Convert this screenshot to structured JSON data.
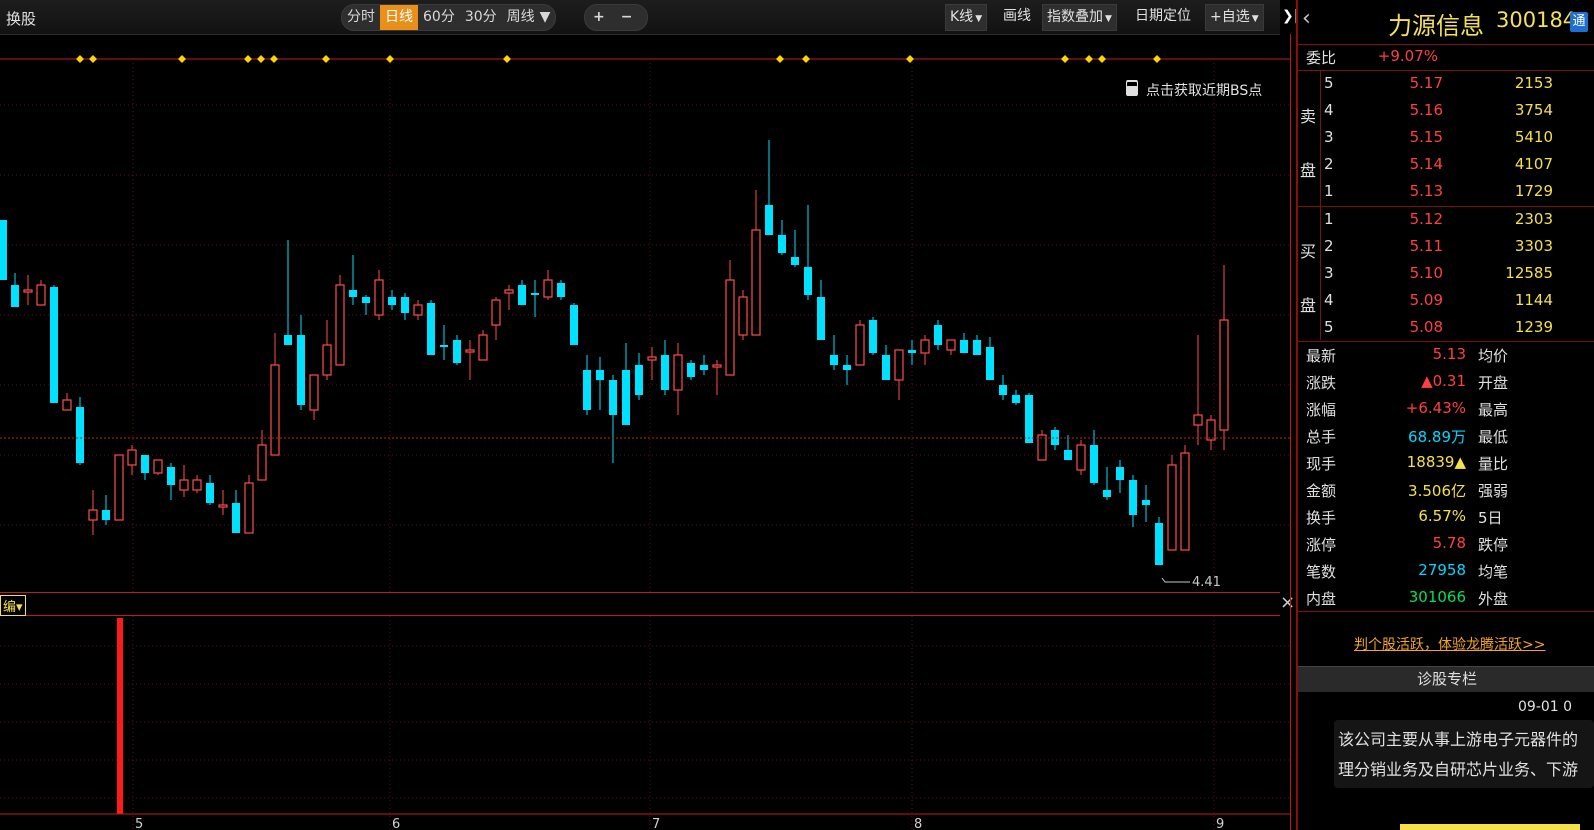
{
  "toolbar": {
    "left_label": "换股",
    "periods": [
      "分时",
      "日线",
      "60分",
      "30分",
      "周线"
    ],
    "active_period": "日线",
    "zoom_in": "+",
    "zoom_out": "−",
    "kline_label": "K线",
    "draw_label": "画线",
    "index_overlay_label": "指数叠加",
    "date_locate_label": "日期定位",
    "add_watch_label": "+自选",
    "collapse_icon": "❯|"
  },
  "chart": {
    "bs_prompt": "点击获取近期BS点",
    "low_label": "4.41",
    "colors": {
      "up": "#ff4d4d",
      "down": "#00e0ff",
      "marker": "#ffd400",
      "grid": "#5a1010"
    }
  },
  "indicator": {
    "header_label": "编",
    "close_icon": "×"
  },
  "x_axis": {
    "labels": [
      "5",
      "6",
      "7",
      "8",
      "9"
    ]
  },
  "chart_data": {
    "type": "candlestick",
    "y_range": [
      4.35,
      5.85
    ],
    "x_axis_labels": [
      "5",
      "6",
      "7",
      "8",
      "9"
    ],
    "candles": [
      {
        "o": 5.08,
        "h": 5.12,
        "l": 4.95,
        "c": 5.22,
        "up": true
      },
      {
        "o": 5.12,
        "h": 5.13,
        "l": 5.03,
        "c": 5.05,
        "up": false
      },
      {
        "o": 5.1,
        "h": 5.15,
        "l": 5.03,
        "c": 5.11,
        "up": true
      },
      {
        "o": 5.11,
        "h": 5.14,
        "l": 5.02,
        "c": 5.06,
        "up": false
      },
      {
        "o": 5.07,
        "h": 5.16,
        "l": 5.03,
        "c": 5.1,
        "up": true
      },
      {
        "o": 5.1,
        "h": 5.11,
        "l": 4.85,
        "c": 4.87,
        "up": false
      },
      {
        "o": 4.86,
        "h": 4.88,
        "l": 4.82,
        "c": 4.84,
        "up": false
      },
      {
        "o": 4.84,
        "h": 4.86,
        "l": 4.64,
        "c": 4.66,
        "up": false
      }
    ],
    "annotation_low": 4.41
  },
  "right_panel": {
    "back_icon": "‹",
    "stock_name": "力源信息",
    "stock_code": "300184",
    "badge": "通",
    "weibi_label": "委比",
    "weibi_value": "+9.07%",
    "sell_side_label_1": "卖",
    "sell_side_label_2": "盘",
    "buy_side_label_1": "买",
    "buy_side_label_2": "盘",
    "sell": [
      {
        "level": "5",
        "price": "5.17",
        "vol": "2153"
      },
      {
        "level": "4",
        "price": "5.16",
        "vol": "3754"
      },
      {
        "level": "3",
        "price": "5.15",
        "vol": "5410"
      },
      {
        "level": "2",
        "price": "5.14",
        "vol": "4107"
      },
      {
        "level": "1",
        "price": "5.13",
        "vol": "1729"
      }
    ],
    "buy": [
      {
        "level": "1",
        "price": "5.12",
        "vol": "2303"
      },
      {
        "level": "2",
        "price": "5.11",
        "vol": "3303"
      },
      {
        "level": "3",
        "price": "5.10",
        "vol": "12585"
      },
      {
        "level": "4",
        "price": "5.09",
        "vol": "1144"
      },
      {
        "level": "5",
        "price": "5.08",
        "vol": "1239"
      }
    ],
    "stats": [
      {
        "label": "最新",
        "value": "5.13",
        "label2": "均价"
      },
      {
        "label": "涨跌",
        "value": "▲0.31",
        "label2": "开盘"
      },
      {
        "label": "涨幅",
        "value": "+6.43%",
        "label2": "最高"
      },
      {
        "label": "总手",
        "value": "68.89万",
        "label2": "最低"
      },
      {
        "label": "现手",
        "value": "18839▲",
        "label2": "量比"
      },
      {
        "label": "金额",
        "value": "3.506亿",
        "label2": "强弱"
      },
      {
        "label": "换手",
        "value": "6.57%",
        "label2": "5日"
      },
      {
        "label": "涨停",
        "value": "5.78",
        "label2": "跌停"
      },
      {
        "label": "笔数",
        "value": "27958",
        "label2": "均笔"
      },
      {
        "label": "内盘",
        "value": "301066",
        "label2": "外盘"
      }
    ],
    "promo_link": "判个股活跃，体验龙腾活跃>>",
    "column_title": "诊股专栏",
    "news_date": "09-01 0",
    "news_text_1": "该公司主要从事上游电子元器件的",
    "news_text_2": "理分销业务及自研芯片业务、下游"
  }
}
